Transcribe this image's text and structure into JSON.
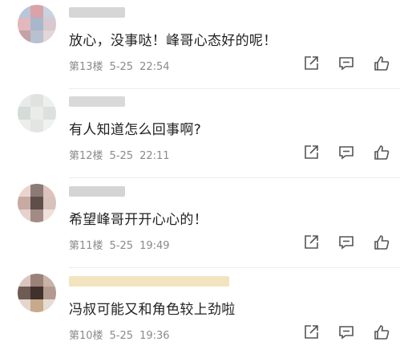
{
  "comments": [
    {
      "content": "放心，没事哒！峰哥心态好的呢！",
      "floor": "第13楼",
      "date": "5-25",
      "time": "22:54",
      "avatar_colors": [
        "#b9c6d9",
        "#d9a3a8",
        "#c8d2e0",
        "#e2b8bc",
        "#a9b7cc",
        "#d7c9cf",
        "#c4a2a8",
        "#b7c1cf",
        "#e4d5d8"
      ],
      "username_color": "#d6d6d6"
    },
    {
      "content": "有人知道怎么回事啊?",
      "floor": "第12楼",
      "date": "5-25",
      "time": "22:11",
      "avatar_colors": [
        "#e8eaea",
        "#dfe3e0",
        "#eef0ee",
        "#d5dcd8",
        "#e9ece9",
        "#dde1de",
        "#eceeed",
        "#e2e5e2",
        "#f0f2f0"
      ],
      "username_color": "#d9d9d9"
    },
    {
      "content": "希望峰哥开开心心的！",
      "floor": "第11楼",
      "date": "5-25",
      "time": "19:49",
      "avatar_colors": [
        "#e9d5cf",
        "#8b7a76",
        "#ddc3bb",
        "#c7aaa2",
        "#5f4e4a",
        "#d9c2bc",
        "#e6d2cc",
        "#a38b85",
        "#f0e0da"
      ],
      "username_color": "#d4d4d4"
    },
    {
      "content": "冯叔可能又和角色较上劲啦",
      "floor": "第10楼",
      "date": "5-25",
      "time": "19:36",
      "avatar_colors": [
        "#d9c7bf",
        "#9a8278",
        "#c9b3a8",
        "#6e5b53",
        "#3f312c",
        "#b39a8f",
        "#e4d6cf",
        "#c8a98a",
        "#e7dbd4"
      ],
      "username_color": "#f1e4bf"
    }
  ],
  "actions": {
    "share_icon": "share-icon",
    "reply_icon": "reply-icon",
    "like_icon": "thumbs-up-icon"
  },
  "colors": {
    "text": "#222222",
    "meta": "#8a8a8a",
    "icon": "#555555"
  }
}
